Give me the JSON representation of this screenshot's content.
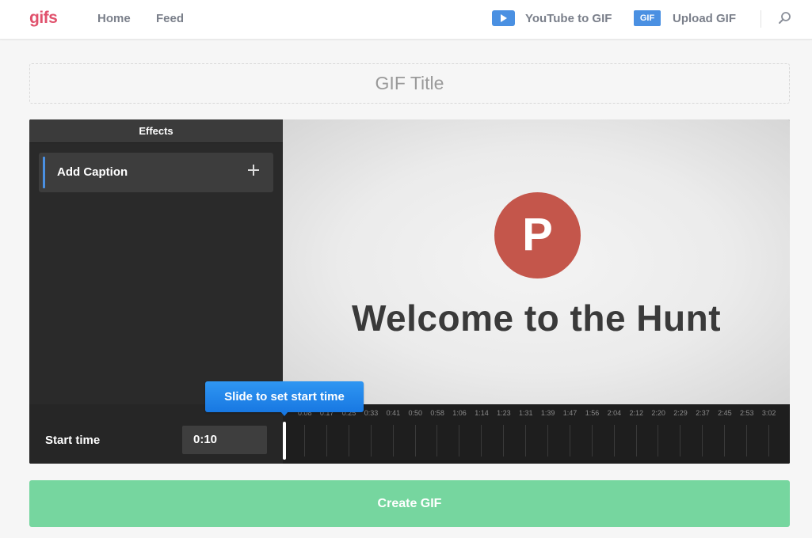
{
  "header": {
    "logo": "gifs",
    "nav": {
      "home": "Home",
      "feed": "Feed"
    },
    "youtube_label": "YouTube to GIF",
    "upload_badge": "GIF",
    "upload_label": "Upload GIF",
    "icons": [
      "play-icon",
      "search-icon"
    ],
    "colors": {
      "brand": "#e0516c",
      "accent": "#4a90e2"
    }
  },
  "title_input": {
    "placeholder": "GIF Title",
    "value": ""
  },
  "effects": {
    "heading": "Effects",
    "items": [
      {
        "label": "Add Caption",
        "icon": "plus-icon"
      }
    ]
  },
  "video": {
    "logo_letter": "P",
    "headline": "Welcome to the Hunt"
  },
  "timeline": {
    "start_label": "Start time",
    "start_value": "0:10",
    "tooltip": "Slide to set start time",
    "ticks": [
      "0:08",
      "0:17",
      "0:25",
      "0:33",
      "0:41",
      "0:50",
      "0:58",
      "1:06",
      "1:14",
      "1:23",
      "1:31",
      "1:39",
      "1:47",
      "1:56",
      "2:04",
      "2:12",
      "2:20",
      "2:29",
      "2:37",
      "2:45",
      "2:53",
      "3:02"
    ]
  },
  "create_button": {
    "label": "Create GIF",
    "color": "#76d69f"
  }
}
